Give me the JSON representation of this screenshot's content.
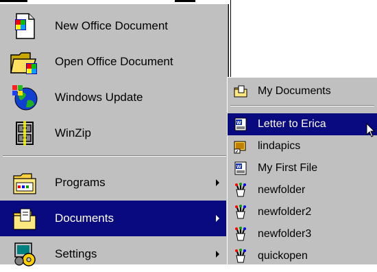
{
  "start_menu": {
    "items": [
      {
        "label": "New Office Document",
        "icon": "new-office-document-icon"
      },
      {
        "label": "Open Office Document",
        "icon": "open-office-document-icon"
      },
      {
        "label": "Windows Update",
        "icon": "windows-update-globe-icon"
      },
      {
        "label": "WinZip",
        "icon": "winzip-cabinet-icon"
      },
      {
        "label": "Programs",
        "icon": "programs-folder-icon",
        "has_submenu": true
      },
      {
        "label": "Documents",
        "icon": "documents-folder-icon",
        "has_submenu": true,
        "selected": true
      },
      {
        "label": "Settings",
        "icon": "settings-icon",
        "has_submenu": true
      }
    ]
  },
  "documents_submenu": {
    "items": [
      {
        "label": "My Documents",
        "icon": "my-documents-folder-icon"
      },
      {
        "label": "Letter to Erica",
        "icon": "word-document-icon",
        "selected": true
      },
      {
        "label": "lindapics",
        "icon": "shortcut-folder-icon"
      },
      {
        "label": "My First File",
        "icon": "word-document-icon"
      },
      {
        "label": "newfolder",
        "icon": "paint-brushes-icon"
      },
      {
        "label": "newfolder2",
        "icon": "paint-brushes-icon"
      },
      {
        "label": "newfolder3",
        "icon": "paint-brushes-icon"
      },
      {
        "label": "quickopen",
        "icon": "paint-brushes-icon"
      }
    ]
  },
  "colors": {
    "menu_background": "#c0c0c0",
    "selection": "#0a0a80",
    "selection_text": "#ffffff"
  }
}
